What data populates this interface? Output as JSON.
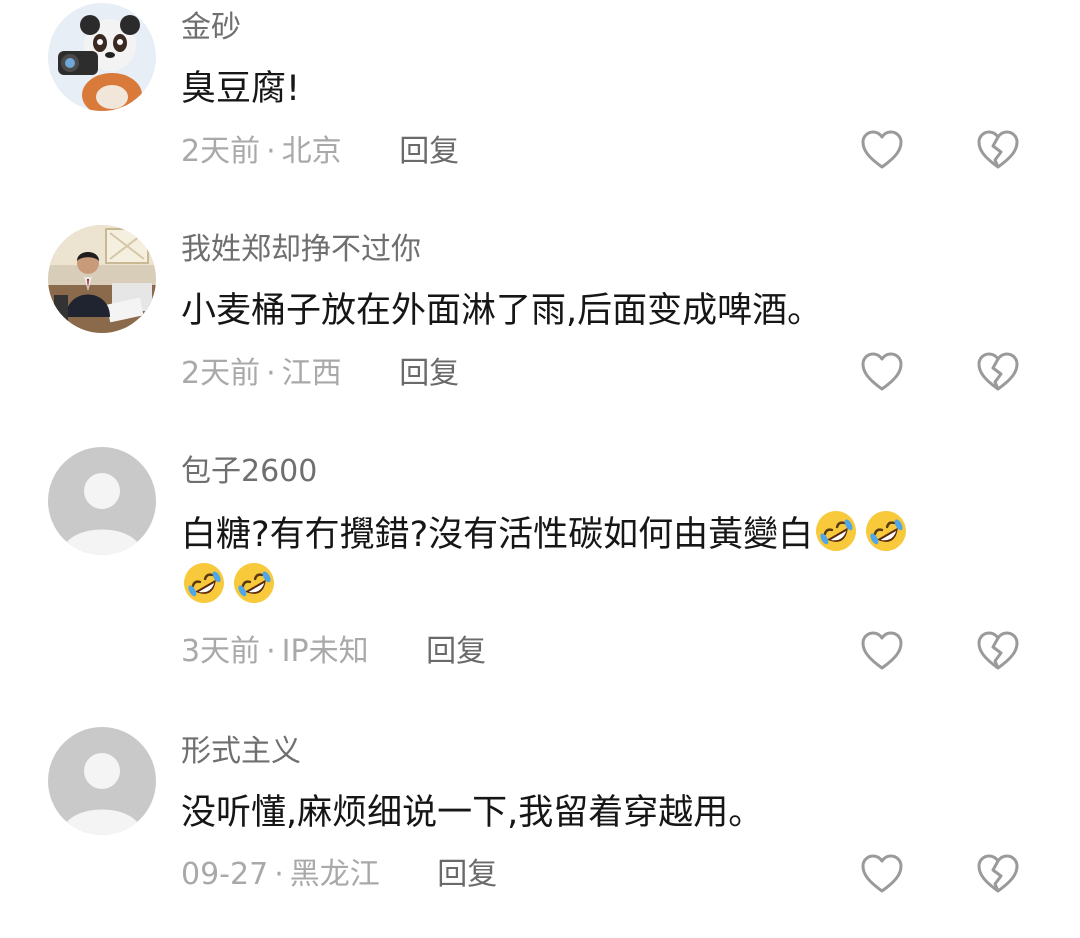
{
  "comments": [
    {
      "username": "金砂",
      "content": "臭豆腐!",
      "time": "2天前",
      "separator": "·",
      "location": "北京",
      "reply_label": "回复",
      "avatar": "panda-cameraman-avatar-icon"
    },
    {
      "username": "我姓郑却挣不过你",
      "content": "小麦桶子放在外面淋了雨,后面变成啤酒。",
      "time": "2天前",
      "separator": "·",
      "location": "江西",
      "reply_label": "回复",
      "avatar": "office-man-photo-avatar"
    },
    {
      "username": "包子2600",
      "content": "白糖?有冇攪錯?沒有活性碳如何由黃變白",
      "emoji_count": 4,
      "emoji": "rolling-on-floor-laughing-icon",
      "time": "3天前",
      "separator": "·",
      "location": "IP未知",
      "reply_label": "回复",
      "avatar": "default-user-avatar-icon"
    },
    {
      "username": "形式主义",
      "content": "没听懂,麻烦细说一下,我留着穿越用。",
      "time": "09-27",
      "separator": "·",
      "location": "黑龙江",
      "reply_label": "回复",
      "avatar": "default-user-avatar-icon"
    }
  ],
  "icons": {
    "like": "heart-outline-icon",
    "dislike": "broken-heart-outline-icon"
  },
  "colors": {
    "username": "#6f6f6f",
    "content": "#161616",
    "meta": "#a9a9a9",
    "icon_stroke": "#9a9a9a",
    "default_avatar_bg": "#c9c9c9"
  }
}
